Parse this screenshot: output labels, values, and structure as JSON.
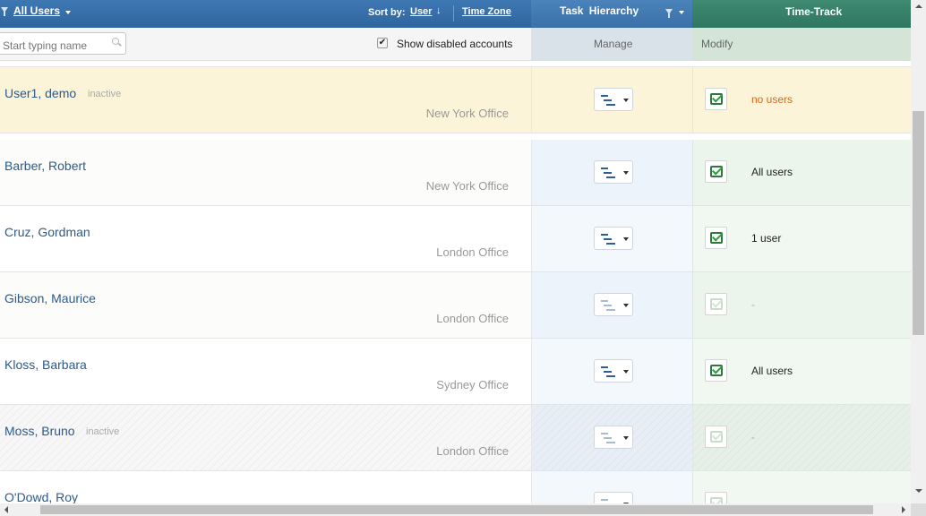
{
  "header": {
    "users_filter_label": "All Users",
    "sort_by_label": "Sort by:",
    "sort_user_label": "User",
    "sort_direction_symbol": "↓",
    "sort_timezone_label": "Time Zone",
    "task_hierarchy_title": "Task Hierarchy",
    "time_track_title": "Time-Track"
  },
  "subheader": {
    "search_placeholder": "Start typing name",
    "show_disabled_label": "Show disabled accounts",
    "show_disabled_checked": true,
    "manage_label": "Manage",
    "modify_label": "Modify"
  },
  "users": [
    {
      "name": "User1, demo",
      "status": "inactive",
      "office": "New York Office",
      "timetrack_text": "no users",
      "timetrack_enabled": true,
      "hierarchy_enabled": true,
      "highlighted": true
    },
    {
      "name": "Barber, Robert",
      "status": "",
      "office": "New York Office",
      "timetrack_text": "All users",
      "timetrack_enabled": true,
      "hierarchy_enabled": true
    },
    {
      "name": "Cruz, Gordman",
      "status": "",
      "office": "London Office",
      "timetrack_text": "1 user",
      "timetrack_enabled": true,
      "hierarchy_enabled": true
    },
    {
      "name": "Gibson, Maurice",
      "status": "",
      "office": "London Office",
      "timetrack_text": "-",
      "timetrack_enabled": false,
      "hierarchy_enabled": false
    },
    {
      "name": "Kloss, Barbara",
      "status": "",
      "office": "Sydney Office",
      "timetrack_text": "All users",
      "timetrack_enabled": true,
      "hierarchy_enabled": true
    },
    {
      "name": "Moss, Bruno",
      "status": "inactive",
      "office": "London Office",
      "timetrack_text": "-",
      "timetrack_enabled": false,
      "hierarchy_enabled": false,
      "disabled": true
    },
    {
      "name": "O'Dowd, Roy",
      "status": "",
      "office": "",
      "timetrack_text": "-",
      "timetrack_enabled": false,
      "hierarchy_enabled": false
    }
  ],
  "colors": {
    "header_blue": "#3a72ad",
    "header_green": "#347d66",
    "highlight_row": "#fbf4d8",
    "user_link": "#2c5a8c",
    "warning_text": "#d2691e"
  }
}
